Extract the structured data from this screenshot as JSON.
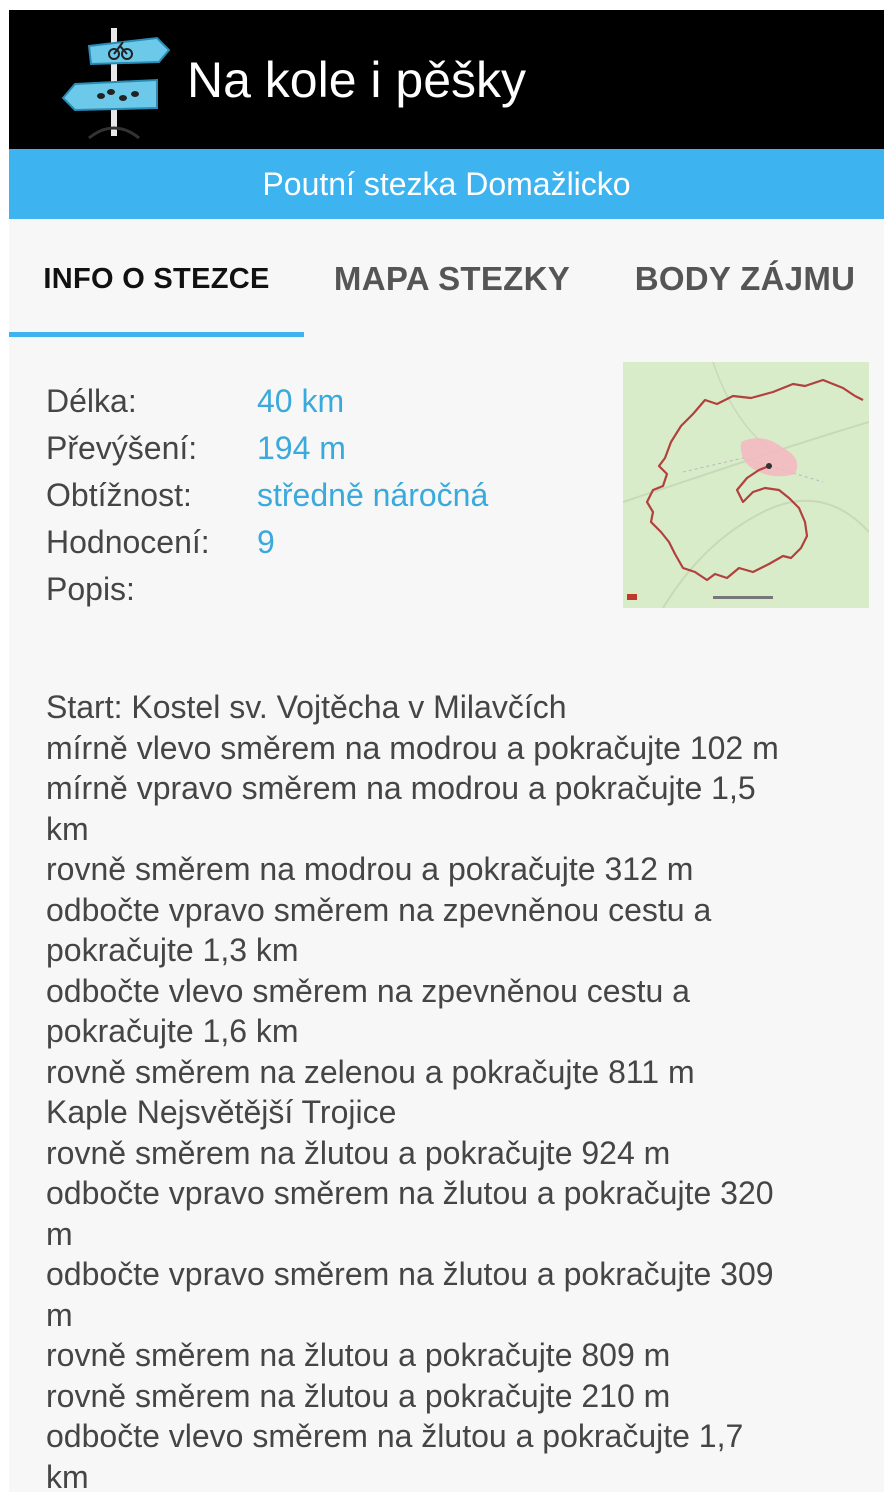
{
  "app": {
    "title": "Na kole i pěšky",
    "logo_icon": "signpost-bike-hiker-icon"
  },
  "trail": {
    "name": "Poutní stezka Domažlicko"
  },
  "tabs": [
    {
      "label": "INFO O STEZCE",
      "active": true
    },
    {
      "label": "MAPA STEZKY",
      "active": false
    },
    {
      "label": "BODY ZÁJMU",
      "active": false
    }
  ],
  "info": {
    "length_label": "Délka:",
    "length_value": "40 km",
    "elevation_label": "Převýšení:",
    "elevation_value": "194 m",
    "difficulty_label": "Obtížnost:",
    "difficulty_value": "středně náročná",
    "rating_label": "Hodnocení:",
    "rating_value": "9",
    "description_label": "Popis:"
  },
  "description_lines": [
    "Start: Kostel sv. Vojtěcha v Milavčích",
    " mírně vlevo směrem na modrou a pokračujte 102 m",
    " mírně vpravo směrem na modrou a pokračujte 1,5",
    "km",
    " rovně směrem na modrou a pokračujte 312 m",
    " odbočte vpravo směrem na zpevněnou cestu a",
    "pokračujte 1,3 km",
    " odbočte vlevo směrem na zpevněnou cestu a",
    "pokračujte 1,6 km",
    " rovně směrem na zelenou a pokračujte 811 m",
    "Kaple Nejsvětější Trojice",
    " rovně směrem na žlutou a pokračujte 924 m",
    " odbočte vpravo směrem na žlutou a pokračujte 320",
    "m",
    " odbočte vpravo směrem na žlutou a pokračujte 309",
    "m",
    " rovně směrem na žlutou a pokračujte 809 m",
    " rovně směrem na žlutou a pokračujte 210 m",
    " odbočte vlevo směrem na žlutou a pokračujte 1,7",
    "km"
  ],
  "colors": {
    "header_bg": "#000000",
    "accent": "#3db4ef",
    "value_text": "#3aa9db",
    "body_text": "#454545",
    "route_line": "#b0413e",
    "map_bg": "#d9ecc9"
  }
}
